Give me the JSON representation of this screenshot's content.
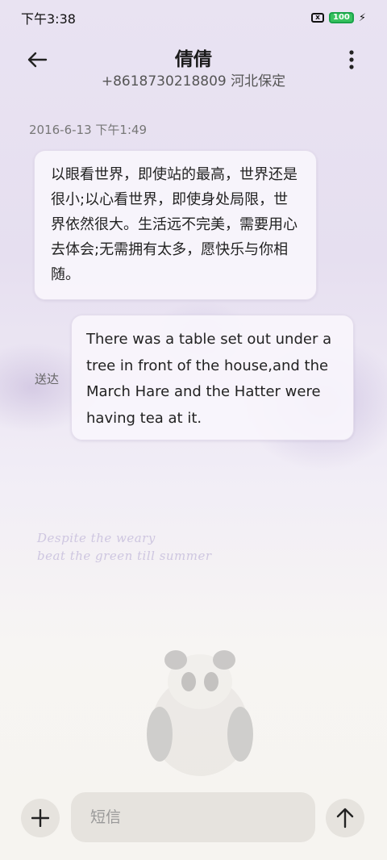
{
  "status_bar": {
    "time": "下午3:38",
    "x_badge": "x",
    "battery": "100"
  },
  "header": {
    "contact_name": "倩倩",
    "contact_sub": "+8618730218809 河北保定",
    "back_icon": "arrow-left-icon",
    "more_icon": "more-vertical-icon"
  },
  "conversation": {
    "timestamp": "2016-6-13 下午1:49",
    "incoming_message": "以眼看世界，即使站的最高，世界还是很小;以心看世界，即使身处局限，世界依然很大。生活远不完美，需要用心去体会;无需拥有太多，愿快乐与你相随。",
    "outgoing_message": "There was a table set out under a tree in front of the house,and the March Hare and the Hatter were having tea at it.",
    "delivered_status": "送达"
  },
  "background_art": {
    "script_line_1": "Despite the weary",
    "script_line_2": "beat the green   till summer"
  },
  "composer": {
    "placeholder": "短信",
    "add_icon": "plus-icon",
    "send_icon": "arrow-up-icon"
  },
  "colors": {
    "bubble_bg": "#f8f5fc",
    "bubble_border": "#e3dcec",
    "battery": "#37c25f",
    "composer_bg": "#f6f4f0"
  }
}
